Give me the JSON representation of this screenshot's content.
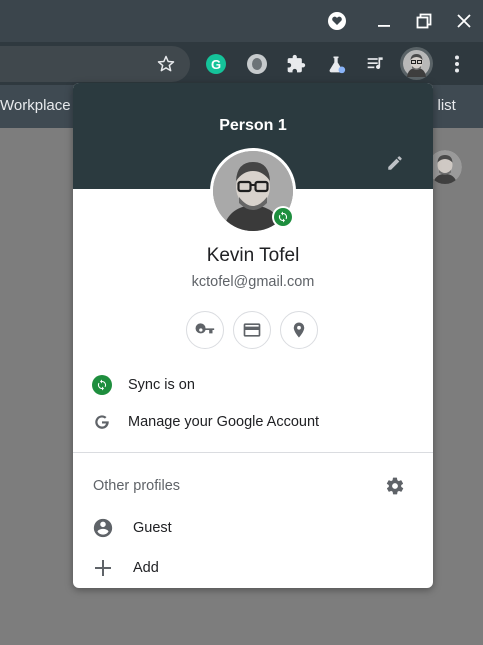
{
  "toolbar": {
    "extensions": [
      "grammarly-icon",
      "extension-icon",
      "puzzle-icon",
      "labs-icon",
      "media-control-icon"
    ]
  },
  "bookmarks": {
    "left_item": "Workplace",
    "right_item": "g list"
  },
  "profile_menu": {
    "header_title": "Person 1",
    "user_name": "Kevin Tofel",
    "user_email": "kctofel@gmail.com",
    "quick_actions": [
      "passwords-key-icon",
      "payment-card-icon",
      "addresses-location-icon"
    ],
    "sync_label": "Sync is on",
    "manage_account_label": "Manage your Google Account",
    "other_profiles_title": "Other profiles",
    "guest_label": "Guest",
    "add_label": "Add"
  },
  "colors": {
    "header_bg": "#2b3a3f",
    "sync_green": "#1e8e3e",
    "titlebar_bg": "#3b454c"
  }
}
